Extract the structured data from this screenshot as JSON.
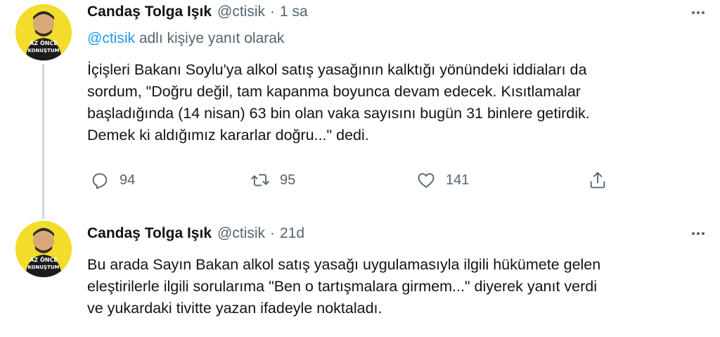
{
  "tweets": [
    {
      "name": "Candaş Tolga Işık",
      "handle": "@ctisik",
      "dot": "·",
      "time": "1 sa",
      "reply_to": {
        "mention": "@ctisik",
        "suffix": "adlı kişiye yanıt olarak"
      },
      "text_lines": [
        "İçişleri Bakanı Soylu'ya alkol satış yasağının kalktığı yönündeki iddiaları da",
        "sordum, \"Doğru değil, tam kapanma boyunca devam edecek. Kısıtlamalar",
        "başladığında (14 nisan) 63 bin olan vaka sayısını bugün 31 binlere getirdik.",
        "Demek ki aldığımız kararlar doğru...\" dedi."
      ],
      "actions": {
        "reply_count": "94",
        "retweet_count": "95",
        "like_count": "141"
      },
      "avatar_text": "AZ ÖNCE KONUŞTUM"
    },
    {
      "name": "Candaş Tolga Işık",
      "handle": "@ctisik",
      "dot": "·",
      "time": "21d",
      "text_lines": [
        "Bu arada Sayın Bakan alkol satış yasağı uygulamasıyla ilgili hükümete gelen",
        "eleştirilerle ilgili sorularıma \"Ben o tartışmalara girmem...\" diyerek yanıt verdi",
        "ve yukardaki tivitte yazan ifadeyle noktaladı."
      ],
      "avatar_text": "AZ ÖNCE KONUŞTUM"
    }
  ],
  "colors": {
    "text": "#0f1419",
    "secondary": "#536471",
    "link": "#1d9bf0",
    "thread_line": "#cfd9de",
    "avatar_bg": "#f3dc2a"
  },
  "icons": {
    "reply": "reply-icon",
    "retweet": "retweet-icon",
    "like": "heart-icon",
    "share": "share-icon",
    "more": "more-icon"
  }
}
